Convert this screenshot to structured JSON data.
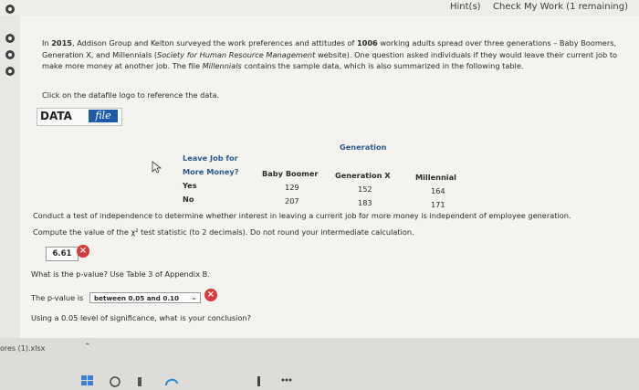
{
  "header": {
    "hint_label": "Hint(s)",
    "check_work_label": "Check My Work (1 remaining)"
  },
  "problem": {
    "intro_parts": [
      "In ",
      "2015",
      ", Addison Group and Kelton surveyed the work preferences and attitudes of ",
      "1006",
      " working adults spread over three generations – Baby Boomers, Generation X, and Millennials (",
      "Society for Human Resource Management",
      " website). One question asked individuals if they would leave their current job to make more money at another job. The file ",
      "Millennials",
      " contains the sample data, which is also summarized in the following table."
    ],
    "click_datafile": "Click on the datafile logo to reference the data.",
    "datafile_text": "DATA",
    "datafile_badge": "file"
  },
  "table": {
    "group_header": "Generation",
    "row_header_line1": "Leave Job for",
    "row_header_line2": "More Money?",
    "columns": [
      "Baby Boomer",
      "Generation X",
      "Millennial"
    ],
    "rows": [
      {
        "label": "Yes",
        "values": [
          "129",
          "152",
          "164"
        ]
      },
      {
        "label": "No",
        "values": [
          "207",
          "183",
          "171"
        ]
      }
    ]
  },
  "questions": {
    "conduct_test": "Conduct a test of independence to determine whether interest in leaving a current job for more money is independent of employee generation.",
    "compute_value": "Compute the value of the χ² test statistic (to 2 decimals). Do not round your intermediate calculation.",
    "answer_value": "6.61",
    "pvalue_question_prefix": "What is the p-value? Use Table 3 of Appendix B.",
    "pvalue_label": "The p-value is",
    "pvalue_selected": "between 0.05 and 0.10",
    "conclusion_question": "Using a 0.05 level of significance, what is your conclusion?"
  },
  "footer": {
    "file_label": "ores (1).xlsx"
  }
}
